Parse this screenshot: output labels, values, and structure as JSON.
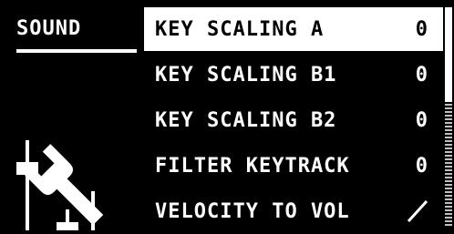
{
  "section": {
    "title": "SOUND"
  },
  "menu": {
    "items": [
      {
        "label": "KEY SCALING A",
        "value": "0"
      },
      {
        "label": "KEY SCALING B1",
        "value": "0"
      },
      {
        "label": "KEY SCALING B2",
        "value": "0"
      },
      {
        "label": "FILTER KEYTRACK",
        "value": "0"
      },
      {
        "label": "VELOCITY TO VOL",
        "value_icon": "diagonal-slash-icon"
      }
    ],
    "selected_index": 0
  },
  "icons": {
    "section_icon": "wrench-and-faders-icon"
  },
  "scroll": {
    "position": 0,
    "visible_fraction": 0.43
  }
}
